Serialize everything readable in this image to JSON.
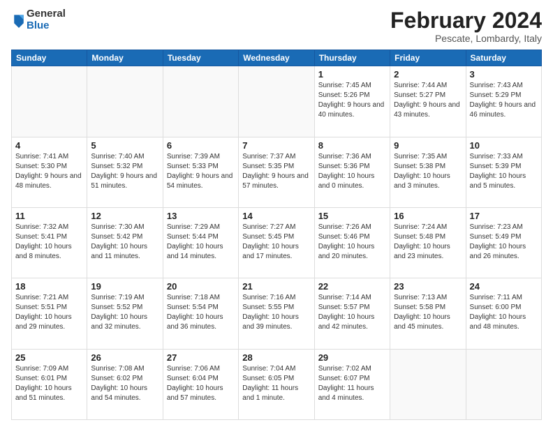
{
  "logo": {
    "general": "General",
    "blue": "Blue"
  },
  "header": {
    "month": "February 2024",
    "location": "Pescate, Lombardy, Italy"
  },
  "weekdays": [
    "Sunday",
    "Monday",
    "Tuesday",
    "Wednesday",
    "Thursday",
    "Friday",
    "Saturday"
  ],
  "weeks": [
    [
      {
        "day": "",
        "detail": ""
      },
      {
        "day": "",
        "detail": ""
      },
      {
        "day": "",
        "detail": ""
      },
      {
        "day": "",
        "detail": ""
      },
      {
        "day": "1",
        "detail": "Sunrise: 7:45 AM\nSunset: 5:26 PM\nDaylight: 9 hours\nand 40 minutes."
      },
      {
        "day": "2",
        "detail": "Sunrise: 7:44 AM\nSunset: 5:27 PM\nDaylight: 9 hours\nand 43 minutes."
      },
      {
        "day": "3",
        "detail": "Sunrise: 7:43 AM\nSunset: 5:29 PM\nDaylight: 9 hours\nand 46 minutes."
      }
    ],
    [
      {
        "day": "4",
        "detail": "Sunrise: 7:41 AM\nSunset: 5:30 PM\nDaylight: 9 hours\nand 48 minutes."
      },
      {
        "day": "5",
        "detail": "Sunrise: 7:40 AM\nSunset: 5:32 PM\nDaylight: 9 hours\nand 51 minutes."
      },
      {
        "day": "6",
        "detail": "Sunrise: 7:39 AM\nSunset: 5:33 PM\nDaylight: 9 hours\nand 54 minutes."
      },
      {
        "day": "7",
        "detail": "Sunrise: 7:37 AM\nSunset: 5:35 PM\nDaylight: 9 hours\nand 57 minutes."
      },
      {
        "day": "8",
        "detail": "Sunrise: 7:36 AM\nSunset: 5:36 PM\nDaylight: 10 hours\nand 0 minutes."
      },
      {
        "day": "9",
        "detail": "Sunrise: 7:35 AM\nSunset: 5:38 PM\nDaylight: 10 hours\nand 3 minutes."
      },
      {
        "day": "10",
        "detail": "Sunrise: 7:33 AM\nSunset: 5:39 PM\nDaylight: 10 hours\nand 5 minutes."
      }
    ],
    [
      {
        "day": "11",
        "detail": "Sunrise: 7:32 AM\nSunset: 5:41 PM\nDaylight: 10 hours\nand 8 minutes."
      },
      {
        "day": "12",
        "detail": "Sunrise: 7:30 AM\nSunset: 5:42 PM\nDaylight: 10 hours\nand 11 minutes."
      },
      {
        "day": "13",
        "detail": "Sunrise: 7:29 AM\nSunset: 5:44 PM\nDaylight: 10 hours\nand 14 minutes."
      },
      {
        "day": "14",
        "detail": "Sunrise: 7:27 AM\nSunset: 5:45 PM\nDaylight: 10 hours\nand 17 minutes."
      },
      {
        "day": "15",
        "detail": "Sunrise: 7:26 AM\nSunset: 5:46 PM\nDaylight: 10 hours\nand 20 minutes."
      },
      {
        "day": "16",
        "detail": "Sunrise: 7:24 AM\nSunset: 5:48 PM\nDaylight: 10 hours\nand 23 minutes."
      },
      {
        "day": "17",
        "detail": "Sunrise: 7:23 AM\nSunset: 5:49 PM\nDaylight: 10 hours\nand 26 minutes."
      }
    ],
    [
      {
        "day": "18",
        "detail": "Sunrise: 7:21 AM\nSunset: 5:51 PM\nDaylight: 10 hours\nand 29 minutes."
      },
      {
        "day": "19",
        "detail": "Sunrise: 7:19 AM\nSunset: 5:52 PM\nDaylight: 10 hours\nand 32 minutes."
      },
      {
        "day": "20",
        "detail": "Sunrise: 7:18 AM\nSunset: 5:54 PM\nDaylight: 10 hours\nand 36 minutes."
      },
      {
        "day": "21",
        "detail": "Sunrise: 7:16 AM\nSunset: 5:55 PM\nDaylight: 10 hours\nand 39 minutes."
      },
      {
        "day": "22",
        "detail": "Sunrise: 7:14 AM\nSunset: 5:57 PM\nDaylight: 10 hours\nand 42 minutes."
      },
      {
        "day": "23",
        "detail": "Sunrise: 7:13 AM\nSunset: 5:58 PM\nDaylight: 10 hours\nand 45 minutes."
      },
      {
        "day": "24",
        "detail": "Sunrise: 7:11 AM\nSunset: 6:00 PM\nDaylight: 10 hours\nand 48 minutes."
      }
    ],
    [
      {
        "day": "25",
        "detail": "Sunrise: 7:09 AM\nSunset: 6:01 PM\nDaylight: 10 hours\nand 51 minutes."
      },
      {
        "day": "26",
        "detail": "Sunrise: 7:08 AM\nSunset: 6:02 PM\nDaylight: 10 hours\nand 54 minutes."
      },
      {
        "day": "27",
        "detail": "Sunrise: 7:06 AM\nSunset: 6:04 PM\nDaylight: 10 hours\nand 57 minutes."
      },
      {
        "day": "28",
        "detail": "Sunrise: 7:04 AM\nSunset: 6:05 PM\nDaylight: 11 hours\nand 1 minute."
      },
      {
        "day": "29",
        "detail": "Sunrise: 7:02 AM\nSunset: 6:07 PM\nDaylight: 11 hours\nand 4 minutes."
      },
      {
        "day": "",
        "detail": ""
      },
      {
        "day": "",
        "detail": ""
      }
    ]
  ]
}
